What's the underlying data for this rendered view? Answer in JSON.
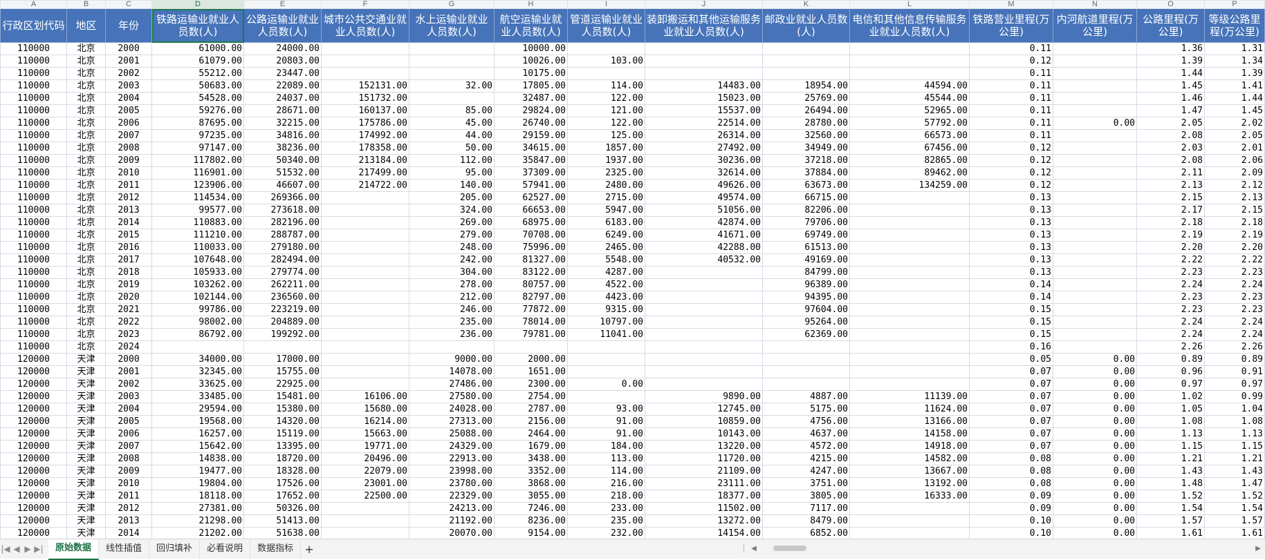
{
  "sheet": {
    "column_letters": [
      "A",
      "B",
      "C",
      "D",
      "E",
      "F",
      "G",
      "H",
      "I",
      "J",
      "K",
      "L",
      "M",
      "N",
      "O",
      "P"
    ],
    "headers": [
      "行政区划代码",
      "地区",
      "年份",
      "铁路运输业就业人员数(人)",
      "公路运输业就业人员数(人)",
      "城市公共交通业就业人员数(人)",
      "水上运输业就业人员数(人)",
      "航空运输业就业人员数(人)",
      "管道运输业就业人员数(人)",
      "装卸搬运和其他运输服务业就业人员数(人)",
      "邮政业就业人员数(人)",
      "电信和其他信息传输服务业就业人员数(人)",
      "铁路营业里程(万公里)",
      "内河航道里程(万公里)",
      "公路里程(万公里)",
      "等级公路里程(万公里)"
    ],
    "rows": [
      [
        "110000",
        "北京",
        "2000",
        "61000.00",
        "24000.00",
        "",
        "",
        "10000.00",
        "",
        "",
        "",
        "",
        "0.11",
        "",
        "1.36",
        "1.31"
      ],
      [
        "110000",
        "北京",
        "2001",
        "61079.00",
        "20803.00",
        "",
        "",
        "10026.00",
        "103.00",
        "",
        "",
        "",
        "0.12",
        "",
        "1.39",
        "1.34"
      ],
      [
        "110000",
        "北京",
        "2002",
        "55212.00",
        "23447.00",
        "",
        "",
        "10175.00",
        "",
        "",
        "",
        "",
        "0.11",
        "",
        "1.44",
        "1.39"
      ],
      [
        "110000",
        "北京",
        "2003",
        "50683.00",
        "22089.00",
        "152131.00",
        "32.00",
        "17805.00",
        "114.00",
        "14483.00",
        "18954.00",
        "44594.00",
        "0.11",
        "",
        "1.45",
        "1.41"
      ],
      [
        "110000",
        "北京",
        "2004",
        "54528.00",
        "24037.00",
        "151732.00",
        "",
        "32487.00",
        "122.00",
        "15023.00",
        "25769.00",
        "45544.00",
        "0.11",
        "",
        "1.46",
        "1.44"
      ],
      [
        "110000",
        "北京",
        "2005",
        "59276.00",
        "28671.00",
        "160137.00",
        "85.00",
        "29824.00",
        "121.00",
        "15537.00",
        "26494.00",
        "52965.00",
        "0.11",
        "",
        "1.47",
        "1.45"
      ],
      [
        "110000",
        "北京",
        "2006",
        "87695.00",
        "32215.00",
        "175786.00",
        "45.00",
        "26740.00",
        "122.00",
        "22514.00",
        "28780.00",
        "57792.00",
        "0.11",
        "0.00",
        "2.05",
        "2.02"
      ],
      [
        "110000",
        "北京",
        "2007",
        "97235.00",
        "34816.00",
        "174992.00",
        "44.00",
        "29159.00",
        "125.00",
        "26314.00",
        "32560.00",
        "66573.00",
        "0.11",
        "",
        "2.08",
        "2.05"
      ],
      [
        "110000",
        "北京",
        "2008",
        "97147.00",
        "38236.00",
        "178358.00",
        "50.00",
        "34615.00",
        "1857.00",
        "27492.00",
        "34949.00",
        "67456.00",
        "0.12",
        "",
        "2.03",
        "2.01"
      ],
      [
        "110000",
        "北京",
        "2009",
        "117802.00",
        "50340.00",
        "213184.00",
        "112.00",
        "35847.00",
        "1937.00",
        "30236.00",
        "37218.00",
        "82865.00",
        "0.12",
        "",
        "2.08",
        "2.06"
      ],
      [
        "110000",
        "北京",
        "2010",
        "116901.00",
        "51532.00",
        "217499.00",
        "95.00",
        "37309.00",
        "2325.00",
        "32614.00",
        "37884.00",
        "89462.00",
        "0.12",
        "",
        "2.11",
        "2.09"
      ],
      [
        "110000",
        "北京",
        "2011",
        "123906.00",
        "46607.00",
        "214722.00",
        "140.00",
        "57941.00",
        "2480.00",
        "49626.00",
        "63673.00",
        "134259.00",
        "0.12",
        "",
        "2.13",
        "2.12"
      ],
      [
        "110000",
        "北京",
        "2012",
        "114534.00",
        "269366.00",
        "",
        "205.00",
        "62527.00",
        "2715.00",
        "49574.00",
        "66715.00",
        "",
        "0.13",
        "",
        "2.15",
        "2.13"
      ],
      [
        "110000",
        "北京",
        "2013",
        "99577.00",
        "273618.00",
        "",
        "324.00",
        "66653.00",
        "5947.00",
        "51056.00",
        "82206.00",
        "",
        "0.13",
        "",
        "2.17",
        "2.15"
      ],
      [
        "110000",
        "北京",
        "2014",
        "110883.00",
        "282196.00",
        "",
        "269.00",
        "68975.00",
        "6183.00",
        "42874.00",
        "79706.00",
        "",
        "0.13",
        "",
        "2.18",
        "2.18"
      ],
      [
        "110000",
        "北京",
        "2015",
        "111210.00",
        "288787.00",
        "",
        "279.00",
        "70708.00",
        "6249.00",
        "41671.00",
        "69749.00",
        "",
        "0.13",
        "",
        "2.19",
        "2.19"
      ],
      [
        "110000",
        "北京",
        "2016",
        "110033.00",
        "279180.00",
        "",
        "248.00",
        "75996.00",
        "2465.00",
        "42288.00",
        "61513.00",
        "",
        "0.13",
        "",
        "2.20",
        "2.20"
      ],
      [
        "110000",
        "北京",
        "2017",
        "107648.00",
        "282494.00",
        "",
        "242.00",
        "81327.00",
        "5548.00",
        "40532.00",
        "49169.00",
        "",
        "0.13",
        "",
        "2.22",
        "2.22"
      ],
      [
        "110000",
        "北京",
        "2018",
        "105933.00",
        "279774.00",
        "",
        "304.00",
        "83122.00",
        "4287.00",
        "",
        "84799.00",
        "",
        "0.13",
        "",
        "2.23",
        "2.23"
      ],
      [
        "110000",
        "北京",
        "2019",
        "103262.00",
        "262211.00",
        "",
        "278.00",
        "80757.00",
        "4522.00",
        "",
        "96389.00",
        "",
        "0.14",
        "",
        "2.24",
        "2.24"
      ],
      [
        "110000",
        "北京",
        "2020",
        "102144.00",
        "236560.00",
        "",
        "212.00",
        "82797.00",
        "4423.00",
        "",
        "94395.00",
        "",
        "0.14",
        "",
        "2.23",
        "2.23"
      ],
      [
        "110000",
        "北京",
        "2021",
        "99786.00",
        "223219.00",
        "",
        "246.00",
        "77872.00",
        "9315.00",
        "",
        "97604.00",
        "",
        "0.15",
        "",
        "2.23",
        "2.23"
      ],
      [
        "110000",
        "北京",
        "2022",
        "98002.00",
        "204889.00",
        "",
        "235.00",
        "78014.00",
        "10797.00",
        "",
        "95264.00",
        "",
        "0.15",
        "",
        "2.24",
        "2.24"
      ],
      [
        "110000",
        "北京",
        "2023",
        "86792.00",
        "199292.00",
        "",
        "236.00",
        "79781.00",
        "11041.00",
        "",
        "62369.00",
        "",
        "0.15",
        "",
        "2.24",
        "2.24"
      ],
      [
        "110000",
        "北京",
        "2024",
        "",
        "",
        "",
        "",
        "",
        "",
        "",
        "",
        "",
        "0.16",
        "",
        "2.26",
        "2.26"
      ],
      [
        "120000",
        "天津",
        "2000",
        "34000.00",
        "17000.00",
        "",
        "9000.00",
        "2000.00",
        "",
        "",
        "",
        "",
        "0.05",
        "0.00",
        "0.89",
        "0.89"
      ],
      [
        "120000",
        "天津",
        "2001",
        "32345.00",
        "15755.00",
        "",
        "14078.00",
        "1651.00",
        "",
        "",
        "",
        "",
        "0.07",
        "0.00",
        "0.96",
        "0.91"
      ],
      [
        "120000",
        "天津",
        "2002",
        "33625.00",
        "22925.00",
        "",
        "27486.00",
        "2300.00",
        "0.00",
        "",
        "",
        "",
        "0.07",
        "0.00",
        "0.97",
        "0.97"
      ],
      [
        "120000",
        "天津",
        "2003",
        "33485.00",
        "15481.00",
        "16106.00",
        "27580.00",
        "2754.00",
        "",
        "9890.00",
        "4887.00",
        "11139.00",
        "0.07",
        "0.00",
        "1.02",
        "0.99"
      ],
      [
        "120000",
        "天津",
        "2004",
        "29594.00",
        "15380.00",
        "15680.00",
        "24028.00",
        "2787.00",
        "93.00",
        "12745.00",
        "5175.00",
        "11624.00",
        "0.07",
        "0.00",
        "1.05",
        "1.04"
      ],
      [
        "120000",
        "天津",
        "2005",
        "19568.00",
        "14320.00",
        "16214.00",
        "27313.00",
        "2156.00",
        "91.00",
        "10859.00",
        "4756.00",
        "13166.00",
        "0.07",
        "0.00",
        "1.08",
        "1.08"
      ],
      [
        "120000",
        "天津",
        "2006",
        "16257.00",
        "15119.00",
        "15663.00",
        "25088.00",
        "2464.00",
        "91.00",
        "10143.00",
        "4637.00",
        "14158.00",
        "0.07",
        "0.00",
        "1.13",
        "1.13"
      ],
      [
        "120000",
        "天津",
        "2007",
        "15642.00",
        "13395.00",
        "19771.00",
        "24329.00",
        "1679.00",
        "184.00",
        "13220.00",
        "4572.00",
        "14918.00",
        "0.07",
        "0.00",
        "1.15",
        "1.15"
      ],
      [
        "120000",
        "天津",
        "2008",
        "14838.00",
        "18720.00",
        "20496.00",
        "22913.00",
        "3438.00",
        "113.00",
        "11720.00",
        "4215.00",
        "14582.00",
        "0.08",
        "0.00",
        "1.21",
        "1.21"
      ],
      [
        "120000",
        "天津",
        "2009",
        "19477.00",
        "18328.00",
        "22079.00",
        "23998.00",
        "3352.00",
        "114.00",
        "21109.00",
        "4247.00",
        "13667.00",
        "0.08",
        "0.00",
        "1.43",
        "1.43"
      ],
      [
        "120000",
        "天津",
        "2010",
        "19804.00",
        "17526.00",
        "23001.00",
        "23780.00",
        "3868.00",
        "216.00",
        "23111.00",
        "3751.00",
        "13192.00",
        "0.08",
        "0.00",
        "1.48",
        "1.47"
      ],
      [
        "120000",
        "天津",
        "2011",
        "18118.00",
        "17652.00",
        "22500.00",
        "22329.00",
        "3055.00",
        "218.00",
        "18377.00",
        "3805.00",
        "16333.00",
        "0.09",
        "0.00",
        "1.52",
        "1.52"
      ],
      [
        "120000",
        "天津",
        "2012",
        "27381.00",
        "50326.00",
        "",
        "24213.00",
        "7246.00",
        "233.00",
        "11502.00",
        "7117.00",
        "",
        "0.09",
        "0.00",
        "1.54",
        "1.54"
      ],
      [
        "120000",
        "天津",
        "2013",
        "21298.00",
        "51413.00",
        "",
        "21192.00",
        "8236.00",
        "235.00",
        "13272.00",
        "8479.00",
        "",
        "0.10",
        "0.00",
        "1.57",
        "1.57"
      ],
      [
        "120000",
        "天津",
        "2014",
        "21202.00",
        "51638.00",
        "",
        "20070.00",
        "9154.00",
        "232.00",
        "14154.00",
        "6852.00",
        "",
        "0.10",
        "0.00",
        "1.61",
        "1.61"
      ]
    ]
  },
  "tabs": [
    {
      "label": "原始数据",
      "active": true
    },
    {
      "label": "线性插值",
      "active": false
    },
    {
      "label": "回归填补",
      "active": false
    },
    {
      "label": "必看说明",
      "active": false
    },
    {
      "label": "数据指标",
      "active": false
    }
  ],
  "tab_nav": {
    "first": "|◀",
    "prev": "◀",
    "next": "▶",
    "last": "▶|",
    "add": "+"
  },
  "scroll": {
    "left": "◀",
    "right": "▶"
  },
  "colors": {
    "header_bg": "#4673b9",
    "active_tab": "#1e7145",
    "grid": "#d4dbe4"
  }
}
